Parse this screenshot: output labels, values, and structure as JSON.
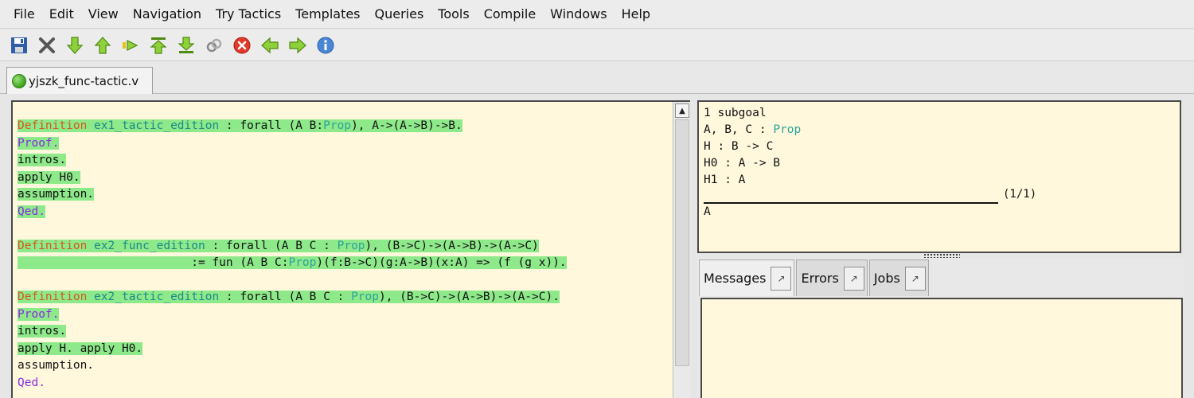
{
  "menu": {
    "items": [
      "File",
      "Edit",
      "View",
      "Navigation",
      "Try Tactics",
      "Templates",
      "Queries",
      "Tools",
      "Compile",
      "Windows",
      "Help"
    ]
  },
  "toolbar": {
    "icons": [
      "save-icon",
      "close-icon",
      "forward-one-icon",
      "backward-one-icon",
      "go-to-cursor-icon",
      "restart-icon",
      "end-icon",
      "link-icon",
      "interrupt-icon",
      "previous-icon",
      "next-icon",
      "about-icon"
    ]
  },
  "tab": {
    "file_label": "yjszk_func-tactic.v",
    "status_color": "#3aa31a"
  },
  "editor": {
    "lines": [
      {
        "highlight": true,
        "parts": [
          {
            "c": "kw",
            "t": "Definition"
          },
          {
            "c": "tx",
            "t": " "
          },
          {
            "c": "id",
            "t": "ex1_tactic_edition"
          },
          {
            "c": "tx",
            "t": " : forall (A B:"
          },
          {
            "c": "ty",
            "t": "Prop"
          },
          {
            "c": "tx",
            "t": "), A->(A->B)->B."
          }
        ]
      },
      {
        "highlight": true,
        "parts": [
          {
            "c": "pf",
            "t": "Proof."
          }
        ]
      },
      {
        "highlight": true,
        "parts": [
          {
            "c": "tx",
            "t": "intros."
          }
        ]
      },
      {
        "highlight": true,
        "parts": [
          {
            "c": "tx",
            "t": "apply H0."
          }
        ]
      },
      {
        "highlight": true,
        "parts": [
          {
            "c": "tx",
            "t": "assumption."
          }
        ]
      },
      {
        "highlight": true,
        "parts": [
          {
            "c": "pf",
            "t": "Qed."
          }
        ]
      },
      {
        "highlight": false,
        "parts": [
          {
            "c": "tx",
            "t": ""
          }
        ]
      },
      {
        "highlight": true,
        "parts": [
          {
            "c": "kw",
            "t": "Definition"
          },
          {
            "c": "tx",
            "t": " "
          },
          {
            "c": "id",
            "t": "ex2_func_edition"
          },
          {
            "c": "tx",
            "t": " : forall (A B C : "
          },
          {
            "c": "ty",
            "t": "Prop"
          },
          {
            "c": "tx",
            "t": "), (B->C)->(A->B)->(A->C)"
          }
        ]
      },
      {
        "highlight": true,
        "parts": [
          {
            "c": "tx",
            "t": "                         := fun (A B C:"
          },
          {
            "c": "ty",
            "t": "Prop"
          },
          {
            "c": "tx",
            "t": ")(f:B->C)(g:A->B)(x:A) => (f (g x))."
          }
        ]
      },
      {
        "highlight": false,
        "parts": [
          {
            "c": "tx",
            "t": ""
          }
        ]
      },
      {
        "highlight": true,
        "parts": [
          {
            "c": "kw",
            "t": "Definition"
          },
          {
            "c": "tx",
            "t": " "
          },
          {
            "c": "id",
            "t": "ex2_tactic_edition"
          },
          {
            "c": "tx",
            "t": " : forall (A B C : "
          },
          {
            "c": "ty",
            "t": "Prop"
          },
          {
            "c": "tx",
            "t": "), (B->C)->(A->B)->(A->C)."
          }
        ]
      },
      {
        "highlight": true,
        "parts": [
          {
            "c": "pf",
            "t": "Proof."
          }
        ]
      },
      {
        "highlight": true,
        "parts": [
          {
            "c": "tx",
            "t": "intros."
          }
        ]
      },
      {
        "highlight": true,
        "parts": [
          {
            "c": "tx",
            "t": "apply H. apply H0."
          }
        ]
      },
      {
        "highlight": false,
        "parts": [
          {
            "c": "tx",
            "t": "assumption."
          }
        ]
      },
      {
        "highlight": false,
        "parts": [
          {
            "c": "pf",
            "t": "Qed."
          }
        ]
      }
    ]
  },
  "goals": {
    "count_label": "1 subgoal",
    "hyp_vars": "A, B, C : ",
    "hyp_vars_type": "Prop",
    "hyps": [
      "H : B -> C",
      "H0 : A -> B",
      "H1 : A"
    ],
    "sep_label": "(1/1)",
    "conclusion": "A"
  },
  "messages": {
    "tabs": [
      {
        "label": "Messages",
        "active": true
      },
      {
        "label": "Errors",
        "active": false
      },
      {
        "label": "Jobs",
        "active": false
      }
    ],
    "detach_glyph": "↗"
  }
}
